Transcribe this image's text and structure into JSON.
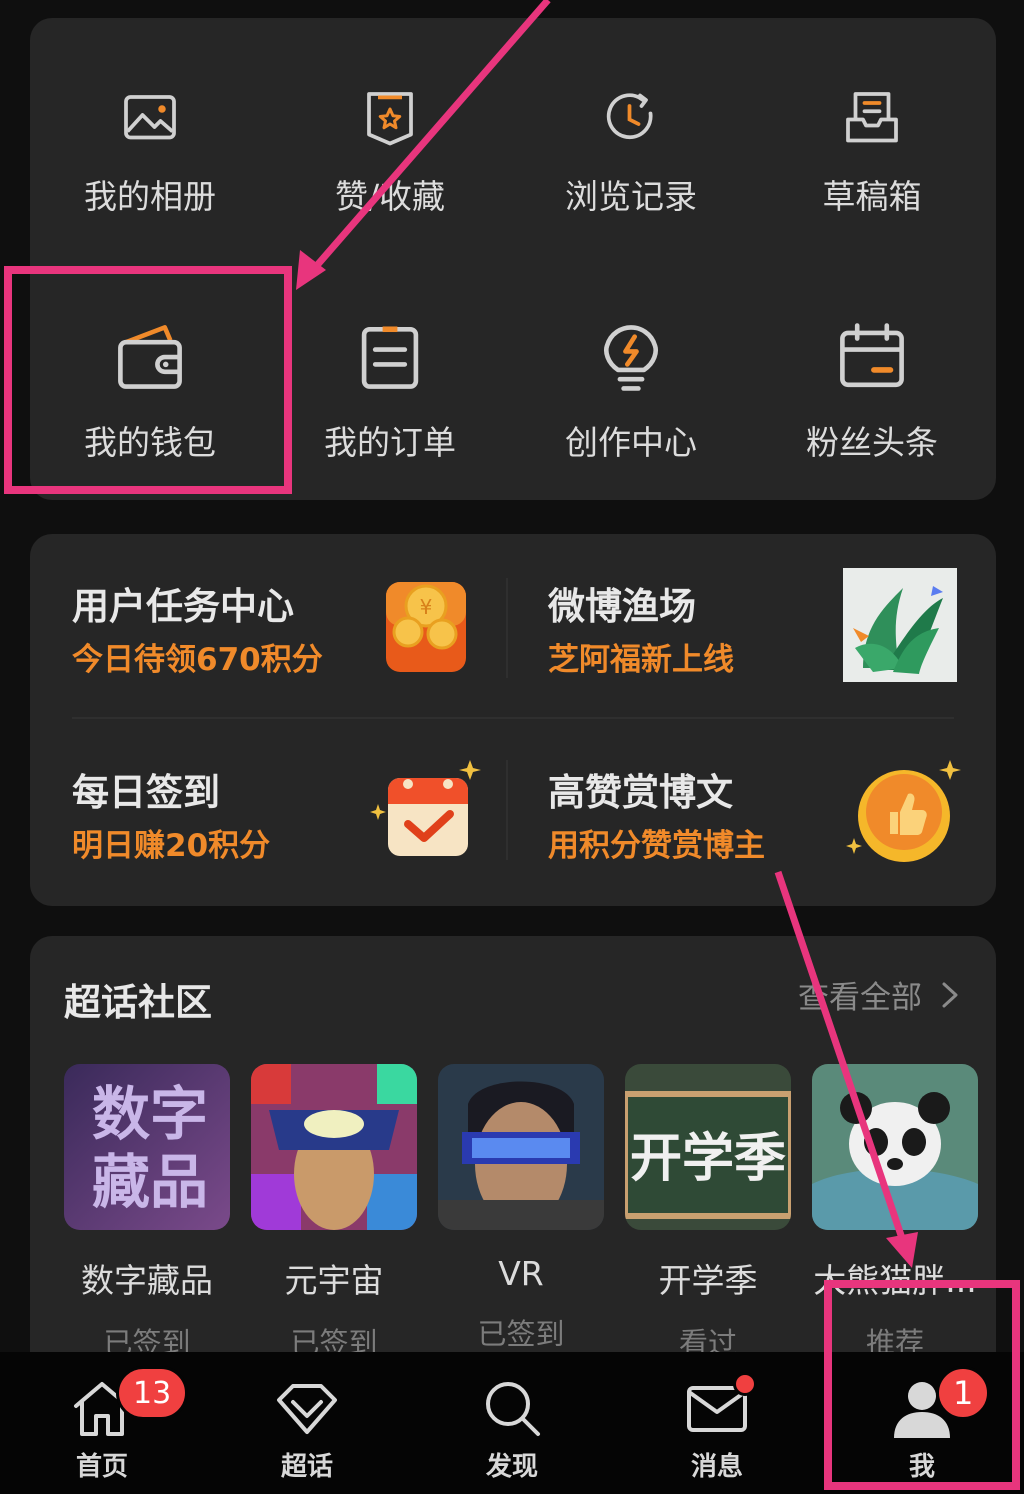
{
  "tools": {
    "items": [
      {
        "label": "我的相册",
        "icon": "photo-album-icon"
      },
      {
        "label": "赞/收藏",
        "icon": "favorites-icon"
      },
      {
        "label": "浏览记录",
        "icon": "history-clock-icon"
      },
      {
        "label": "草稿箱",
        "icon": "drafts-tray-icon"
      },
      {
        "label": "我的钱包",
        "icon": "wallet-icon"
      },
      {
        "label": "我的订单",
        "icon": "orders-list-icon"
      },
      {
        "label": "创作中心",
        "icon": "creator-bulb-icon"
      },
      {
        "label": "粉丝头条",
        "icon": "calendar-icon"
      }
    ]
  },
  "tasks": {
    "items": [
      {
        "title": "用户任务中心",
        "subtitle": "今日待领670积分",
        "icon": "coin-wallet-icon"
      },
      {
        "title": "微博渔场",
        "subtitle": "芝阿福新上线",
        "icon": "plant-icon"
      },
      {
        "title": "每日签到",
        "subtitle": "明日赚20积分",
        "icon": "checkin-calendar-icon"
      },
      {
        "title": "高赞赏博文",
        "subtitle": "用积分赞赏博主",
        "icon": "thumbs-up-coin-icon"
      }
    ]
  },
  "supertopic": {
    "title": "超话社区",
    "more_label": "查看全部",
    "items": [
      {
        "name": "数字藏品",
        "status": "已签到",
        "thumb_text_1": "数字",
        "thumb_text_2": "藏品"
      },
      {
        "name": "元宇宙",
        "status": "已签到"
      },
      {
        "name": "VR",
        "status": "已签到"
      },
      {
        "name": "开学季",
        "status": "看过",
        "thumb_text_1": "开学季"
      },
      {
        "name": "大熊猫胖...",
        "status": "推荐"
      }
    ]
  },
  "bottom_nav": {
    "items": [
      {
        "label": "首页",
        "icon": "home-icon",
        "badge": "13"
      },
      {
        "label": "超话",
        "icon": "diamond-icon"
      },
      {
        "label": "发现",
        "icon": "search-icon"
      },
      {
        "label": "消息",
        "icon": "mail-icon"
      },
      {
        "label": "我",
        "icon": "profile-icon",
        "badge": "1"
      }
    ]
  },
  "colors": {
    "accent_orange": "#f08a2a",
    "annotation_pink": "#e8357d",
    "badge_red": "#f04040",
    "card_bg": "#262626"
  }
}
